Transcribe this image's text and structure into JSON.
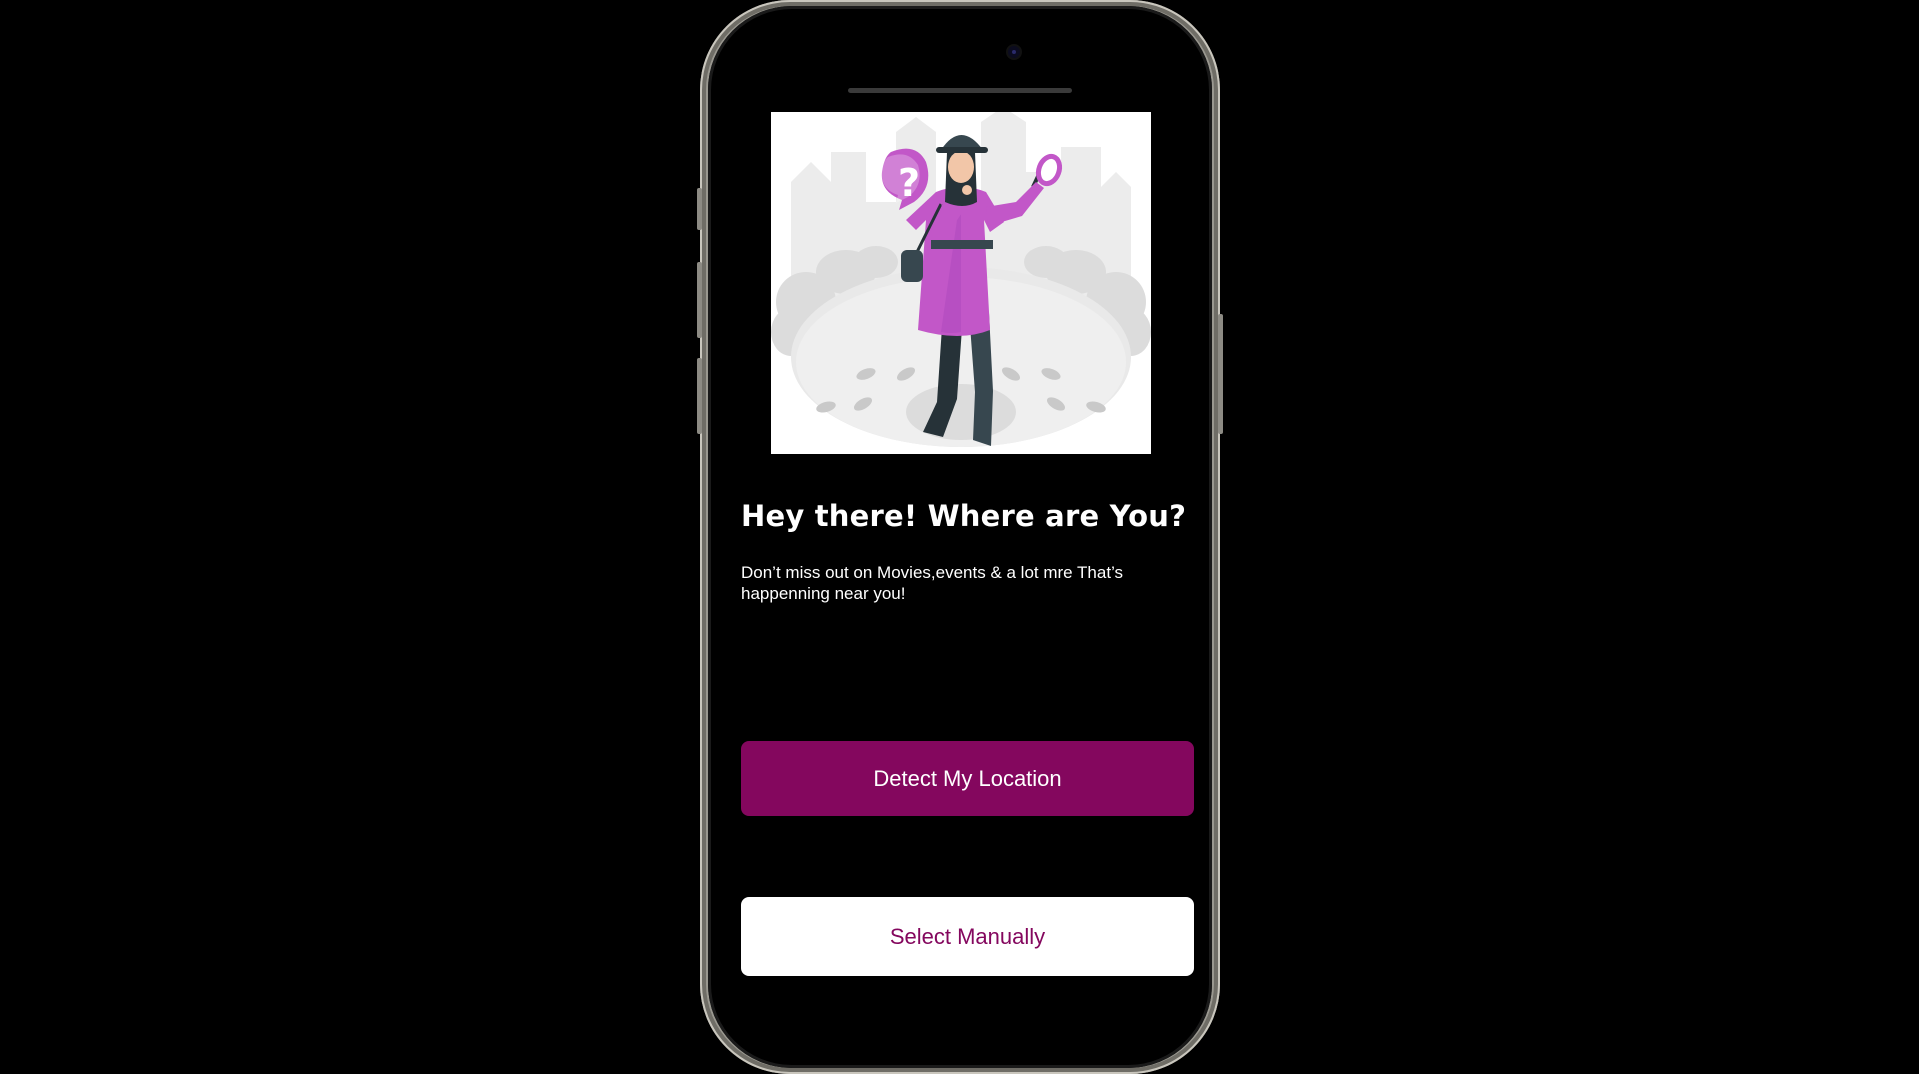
{
  "screen": {
    "heading": "Hey there! Where are You?",
    "description": "Don’t miss out on Movies,events & a lot mre That’s happenning near you!"
  },
  "actions": {
    "detect_location_label": "Detect My Location",
    "select_manually_label": "Select Manually"
  },
  "illustration": {
    "icon": "detective-woman-illustration",
    "bubble_glyph": "?"
  },
  "colors": {
    "brand": "#84075e",
    "background": "#000000",
    "illustration_accent": "#c257c8"
  }
}
